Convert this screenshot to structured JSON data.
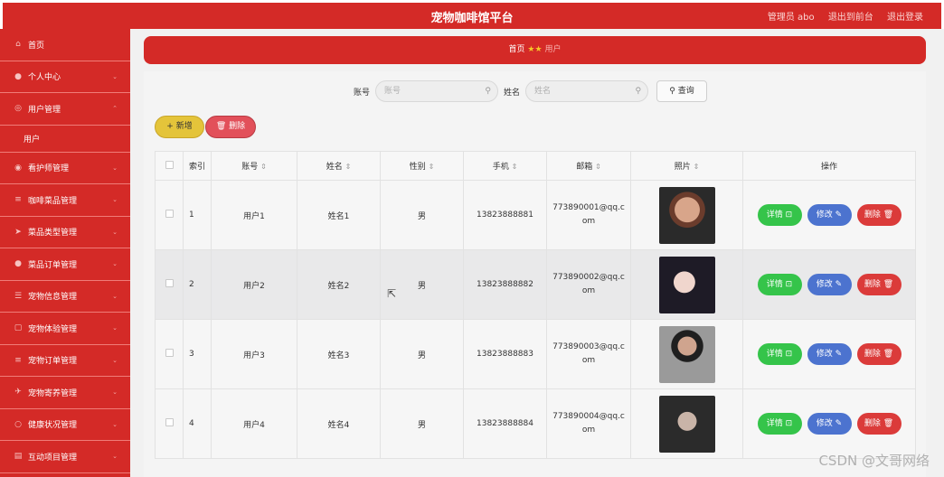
{
  "header": {
    "title": "宠物咖啡馆平台",
    "admin": "管理员 abo",
    "back_link": "退出到前台",
    "logout_link": "退出登录"
  },
  "sidebar": {
    "items": [
      {
        "label": "首页",
        "icon": "home-icon"
      },
      {
        "label": "个人中心",
        "icon": "user-icon"
      },
      {
        "label": "用户管理",
        "icon": "users-icon"
      },
      {
        "label": "看护师管理",
        "icon": "caretaker-icon"
      },
      {
        "label": "咖啡菜品管理",
        "icon": "menu-icon"
      },
      {
        "label": "菜品类型管理",
        "icon": "send-icon"
      },
      {
        "label": "菜品订单管理",
        "icon": "person-icon"
      },
      {
        "label": "宠物信息管理",
        "icon": "list-icon"
      },
      {
        "label": "宠物体验管理",
        "icon": "box-icon"
      },
      {
        "label": "宠物订单管理",
        "icon": "lines-icon"
      },
      {
        "label": "宠物寄养管理",
        "icon": "plane-icon"
      },
      {
        "label": "健康状况管理",
        "icon": "circle-icon"
      },
      {
        "label": "互动项目管理",
        "icon": "doc-icon"
      }
    ],
    "sub_item": "用户"
  },
  "breadcrumb": {
    "home": "首页",
    "current": "用户"
  },
  "search": {
    "account_label": "账号",
    "account_placeholder": "账号",
    "name_label": "姓名",
    "name_placeholder": "姓名",
    "query_button": "查询"
  },
  "actions": {
    "add": "新增",
    "delete": "删除"
  },
  "table": {
    "headers": [
      "索引",
      "账号",
      "姓名",
      "性别",
      "手机",
      "邮箱",
      "照片",
      "操作"
    ],
    "rows": [
      {
        "index": "1",
        "account": "用户1",
        "name": "姓名1",
        "gender": "男",
        "phone": "13823888881",
        "email": "773890001@qq.com"
      },
      {
        "index": "2",
        "account": "用户2",
        "name": "姓名2",
        "gender": "男",
        "phone": "13823888882",
        "email": "773890002@qq.com"
      },
      {
        "index": "3",
        "account": "用户3",
        "name": "姓名3",
        "gender": "男",
        "phone": "13823888883",
        "email": "773890003@qq.com"
      },
      {
        "index": "4",
        "account": "用户4",
        "name": "姓名4",
        "gender": "男",
        "phone": "13823888884",
        "email": "773890004@qq.com"
      }
    ],
    "row_actions": {
      "detail": "详情",
      "edit": "修改",
      "delete": "删除"
    }
  },
  "watermark": "CSDN @文哥网络",
  "colors": {
    "brand": "#d42a27",
    "detail": "#35c44a",
    "edit": "#4c73cf",
    "delete": "#db3b3a",
    "add": "#e4c43a"
  }
}
